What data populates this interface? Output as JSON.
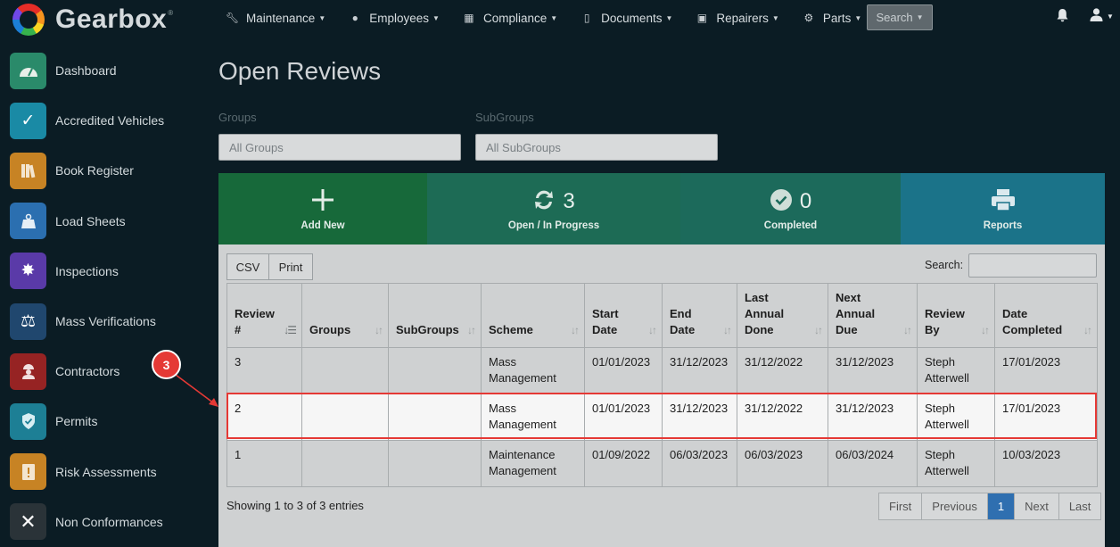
{
  "brand": {
    "name": "Gearbox",
    "tm": "®"
  },
  "topnav": {
    "items": [
      {
        "label": "Maintenance",
        "icon": "wrench-icon"
      },
      {
        "label": "Employees",
        "icon": "person-circle-icon"
      },
      {
        "label": "Compliance",
        "icon": "calendar-check-icon"
      },
      {
        "label": "Documents",
        "icon": "folder-open-icon"
      },
      {
        "label": "Repairers",
        "icon": "address-book-icon"
      },
      {
        "label": "Parts",
        "icon": "gear-icon"
      }
    ],
    "search_label": "Search"
  },
  "sidebar": {
    "items": [
      {
        "label": "Dashboard",
        "icon": "speedometer-icon",
        "color": "#2a8a6a"
      },
      {
        "label": "Accredited Vehicles",
        "icon": "checkmarks-icon",
        "color": "#1a8aa5"
      },
      {
        "label": "Book Register",
        "icon": "books-icon",
        "color": "#c78324"
      },
      {
        "label": "Load Sheets",
        "icon": "weight-icon",
        "color": "#2b6fb0"
      },
      {
        "label": "Inspections",
        "icon": "badge-icon",
        "color": "#5a3aa8"
      },
      {
        "label": "Mass Verifications",
        "icon": "scales-icon",
        "color": "#20476e"
      },
      {
        "label": "Contractors",
        "icon": "worker-icon",
        "color": "#962323"
      },
      {
        "label": "Permits",
        "icon": "shield-check-icon",
        "color": "#1d7f95"
      },
      {
        "label": "Risk Assessments",
        "icon": "alert-doc-icon",
        "color": "#c78324"
      },
      {
        "label": "Non Conformances",
        "icon": "x-icon",
        "color": "#2a3338"
      }
    ]
  },
  "page": {
    "title": "Open Reviews"
  },
  "filters": {
    "groups_label": "Groups",
    "groups_value": "All Groups",
    "subgroups_label": "SubGroups",
    "subgroups_value": "All SubGroups"
  },
  "tiles": [
    {
      "label": "Add New",
      "icon": "plus-icon",
      "color": "#17693a"
    },
    {
      "label": "Open / In Progress",
      "icon": "refresh-icon",
      "count": "3",
      "color": "#1d6b55"
    },
    {
      "label": "Completed",
      "icon": "check-circle-icon",
      "count": "0",
      "color": "#1c6a5b"
    },
    {
      "label": "Reports",
      "icon": "printer-icon",
      "color": "#1b7389"
    }
  ],
  "toolbar": {
    "csv_label": "CSV",
    "print_label": "Print",
    "search_label": "Search:"
  },
  "table": {
    "columns": [
      {
        "line1": "Review",
        "line2": "#"
      },
      {
        "line1": "",
        "line2": "Groups"
      },
      {
        "line1": "",
        "line2": "SubGroups"
      },
      {
        "line1": "",
        "line2": "Scheme"
      },
      {
        "line1": "Start",
        "line2": "Date"
      },
      {
        "line1": "End",
        "line2": "Date"
      },
      {
        "line1": "Last\nAnnual",
        "line2": "Done"
      },
      {
        "line1": "Next\nAnnual",
        "line2": "Due"
      },
      {
        "line1": "Review",
        "line2": "By"
      },
      {
        "line1": "Date",
        "line2": "Completed"
      }
    ],
    "rows": [
      [
        "3",
        "",
        "",
        "Mass Management",
        "01/01/2023",
        "31/12/2023",
        "31/12/2022",
        "31/12/2023",
        "Steph Atterwell",
        "17/01/2023"
      ],
      [
        "2",
        "",
        "",
        "Mass Management",
        "01/01/2023",
        "31/12/2023",
        "31/12/2022",
        "31/12/2023",
        "Steph Atterwell",
        "17/01/2023"
      ],
      [
        "1",
        "",
        "",
        "Maintenance Management",
        "01/09/2022",
        "06/03/2023",
        "06/03/2023",
        "06/03/2024",
        "Steph Atterwell",
        "10/03/2023"
      ]
    ]
  },
  "footer": {
    "showing": "Showing 1 to 3 of 3 entries"
  },
  "pagination": {
    "first": "First",
    "previous": "Previous",
    "current": "1",
    "next": "Next",
    "last": "Last"
  },
  "annotation": {
    "step": "3"
  }
}
